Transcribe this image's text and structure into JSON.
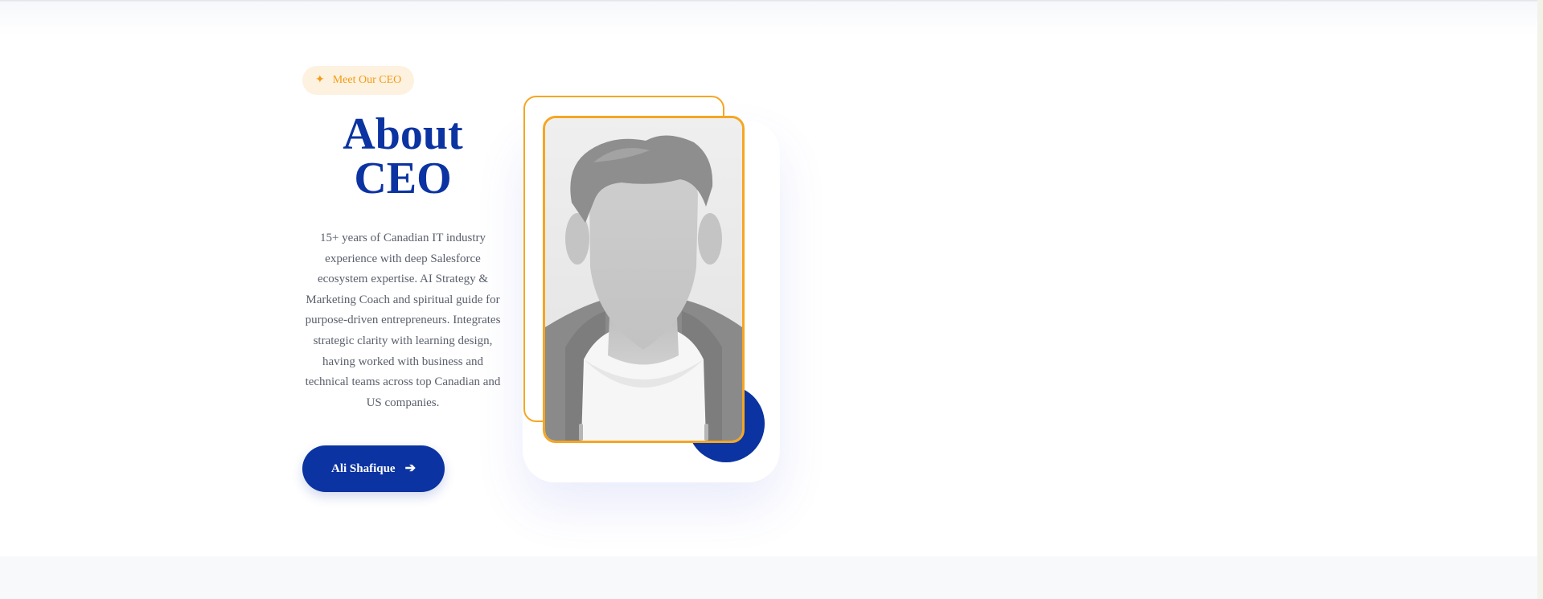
{
  "badge": {
    "icon": "sparkle-icon",
    "label": "Meet Our CEO"
  },
  "title": {
    "line1": "About",
    "line2": "CEO"
  },
  "description": "15+ years of Canadian IT industry experience with deep Salesforce ecosystem expertise. AI Strategy & Marketing Coach and spiritual guide for purpose-driven entrepreneurs. Integrates strategic clarity with learning design, having worked with business and technical teams across top Canadian and US companies.",
  "cta": {
    "label": "Ali Shafique",
    "icon": "arrow-right-icon"
  },
  "colors": {
    "brand_blue": "#0b33a1",
    "accent_orange": "#f5a623",
    "badge_bg": "#fdf1e0",
    "text_muted": "#5a5f6b"
  },
  "photo": {
    "icon": "avatar-placeholder-icon"
  }
}
